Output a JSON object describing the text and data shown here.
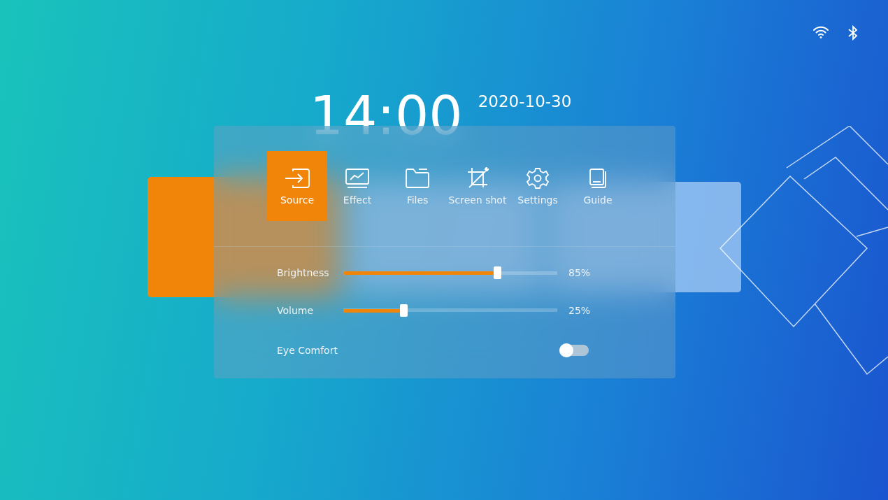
{
  "clock": {
    "time": "14:00",
    "date": "2020-10-30"
  },
  "home_cards": [
    {
      "selected": true
    },
    {
      "selected": false
    },
    {
      "selected": false
    }
  ],
  "quick_panel": {
    "tabs": [
      {
        "label": "Source",
        "selected": true
      },
      {
        "label": "Effect",
        "selected": false
      },
      {
        "label": "Files",
        "selected": false
      },
      {
        "label": "Screen shot",
        "selected": false
      },
      {
        "label": "Settings",
        "selected": false
      },
      {
        "label": "Guide",
        "selected": false
      }
    ],
    "sliders": [
      {
        "label": "Brightness",
        "level": 0.72,
        "reading": "85%"
      },
      {
        "label": "Volume",
        "level": 0.28,
        "reading": "25%"
      }
    ],
    "toggles": [
      {
        "label": "Eye Comfort",
        "on": false
      }
    ]
  }
}
